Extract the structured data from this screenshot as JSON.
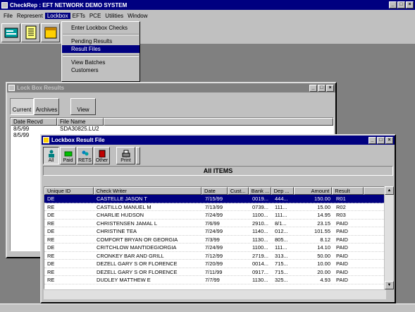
{
  "app": {
    "title": "CheckRep : EFT NETWORK DEMO SYSTEM"
  },
  "menubar": [
    "File",
    "Represent",
    "Lockbox",
    "EFTs",
    "PCE",
    "Utilities",
    "Window"
  ],
  "dropdown": {
    "items": [
      "Enter Lockbox Checks",
      "Pending Results",
      "Result Files",
      "View Batches",
      "Customers"
    ]
  },
  "lockbox_results": {
    "title": "Lock Box Results",
    "buttons": {
      "current": "Current",
      "archives": "Archives",
      "view": "View"
    },
    "columns": [
      "Date Recvd",
      "File Name"
    ],
    "rows": [
      {
        "date": "8/5/99",
        "file": "SDA30825.LU2"
      },
      {
        "date": "8/5/99",
        "file": ""
      }
    ]
  },
  "result_file": {
    "title": "Lockbox Result File",
    "tools": [
      "All",
      "Paid",
      "RETS",
      "Other",
      "Print"
    ],
    "banner": "All ITEMS",
    "columns": [
      "Unique ID",
      "Check Writer",
      "Date",
      "Cust...",
      "Bank ...",
      "Dep ...",
      "Amount",
      "Result"
    ],
    "rows": [
      {
        "id": "DE",
        "writer": "CASTELLE JASON T",
        "date": "7/15/99",
        "cust": "",
        "bank": "0019...",
        "dep": "444...",
        "amount": "150.00",
        "result": "R01"
      },
      {
        "id": "RE",
        "writer": "CASTILLO MANUEL M",
        "date": "7/13/99",
        "cust": "",
        "bank": "0739...",
        "dep": "111...",
        "amount": "15.00",
        "result": "R02"
      },
      {
        "id": "DE",
        "writer": "CHARLIE HUDSON",
        "date": "7/24/99",
        "cust": "",
        "bank": "1100...",
        "dep": "111...",
        "amount": "14.95",
        "result": "R03"
      },
      {
        "id": "RE",
        "writer": "CHRISTENSEN JAMAL L",
        "date": "7/6/99",
        "cust": "",
        "bank": "2910...",
        "dep": "8/1...",
        "amount": "23.15",
        "result": "PAID"
      },
      {
        "id": "DE",
        "writer": "CHRISTINE TEA",
        "date": "7/24/99",
        "cust": "",
        "bank": "1140...",
        "dep": "012...",
        "amount": "101.55",
        "result": "PAID"
      },
      {
        "id": "RE",
        "writer": "COMFORT BRYAN OR GEORGIA",
        "date": "7/3/99",
        "cust": "",
        "bank": "1130...",
        "dep": "805...",
        "amount": "8.12",
        "result": "PAID"
      },
      {
        "id": "DE",
        "writer": "CRITCHLOW MANTIDEGIORGIA",
        "date": "7/24/99",
        "cust": "",
        "bank": "1100...",
        "dep": "111...",
        "amount": "14.10",
        "result": "PAID"
      },
      {
        "id": "RE",
        "writer": "CRONKEY BAR AND GRILL",
        "date": "7/12/99",
        "cust": "",
        "bank": "2719...",
        "dep": "313...",
        "amount": "50.00",
        "result": "PAID"
      },
      {
        "id": "DE",
        "writer": "DEZELL GARY S OR FLORENCE",
        "date": "7/20/99",
        "cust": "",
        "bank": "0014...",
        "dep": "715...",
        "amount": "10.00",
        "result": "PAID"
      },
      {
        "id": "RE",
        "writer": "DEZELL GARY S OR FLORENCE",
        "date": "7/11/99",
        "cust": "",
        "bank": "0917...",
        "dep": "715...",
        "amount": "20.00",
        "result": "PAID"
      },
      {
        "id": "RE",
        "writer": "DUDLEY MATTHEW E",
        "date": "7/7/99",
        "cust": "",
        "bank": "1130...",
        "dep": "325...",
        "amount": "4.93",
        "result": "PAID"
      }
    ]
  }
}
